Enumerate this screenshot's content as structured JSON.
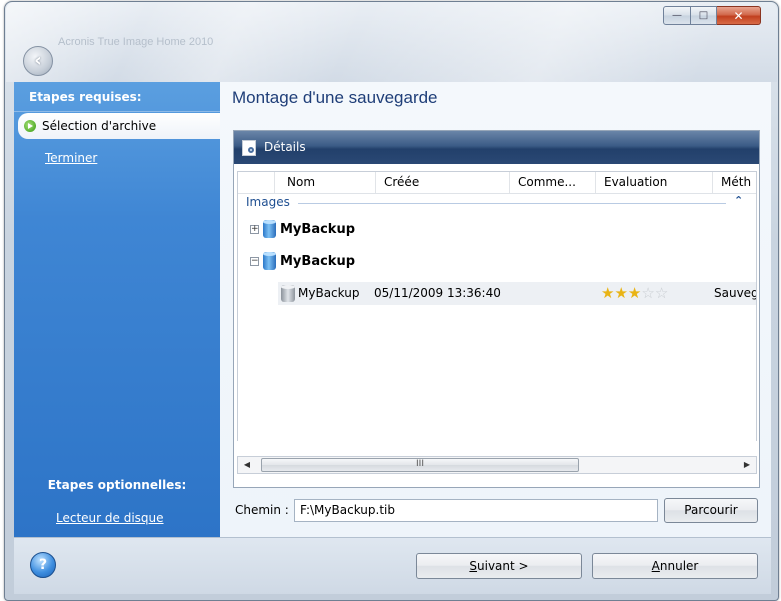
{
  "window": {
    "title": "Acronis True Image Home 2010",
    "controls": {
      "minimize": "—",
      "maximize": "□",
      "close": "✕"
    }
  },
  "sidebar": {
    "required_heading": "Etapes requises:",
    "active_step": "Sélection d'archive",
    "finish_link": "Terminer",
    "optional_heading": "Etapes optionnelles:",
    "disk_reader_link": "Lecteur de disque"
  },
  "main": {
    "page_title": "Montage d'une sauvegarde",
    "details_label": "Détails",
    "columns": [
      "Nom",
      "Créée",
      "Comme...",
      "Evaluation",
      "Méth"
    ],
    "group_label": "Images",
    "tree": [
      {
        "name": "MyBackup",
        "expanded": false
      },
      {
        "name": "MyBackup",
        "expanded": true
      }
    ],
    "archive_row": {
      "name": "MyBackup",
      "created": "05/11/2009 13:36:40",
      "rating": 3,
      "rating_max": 5,
      "method": "Sauveg"
    },
    "scroll_grip": "III",
    "path_label": "Chemin :",
    "path_value": "F:\\MyBackup.tib",
    "browse_button": "Parcourir"
  },
  "footer": {
    "help_symbol": "?",
    "next_button_accel": "S",
    "next_button_rest": "uivant >",
    "cancel_button_accel": "A",
    "cancel_button_rest": "nnuler"
  },
  "colors": {
    "sidebar_blue": "#3f86d4",
    "details_bar": "#2a4874",
    "title_text": "#1f3e78",
    "star": "#e9b416"
  }
}
